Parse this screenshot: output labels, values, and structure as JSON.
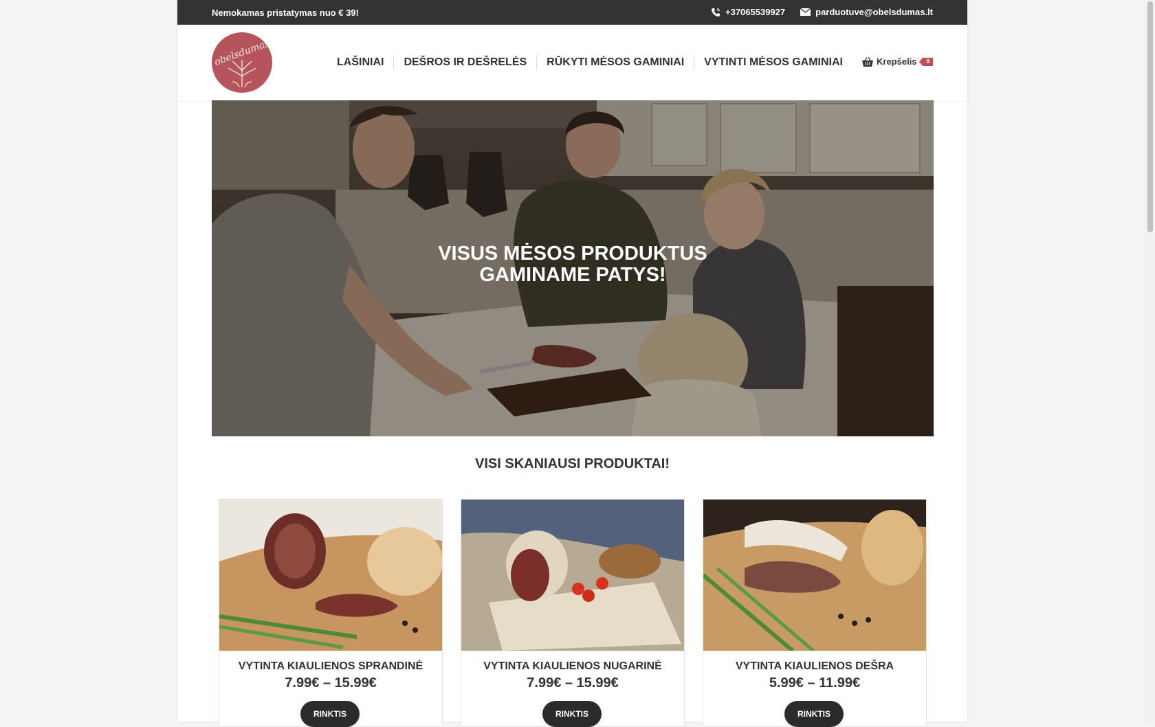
{
  "topbar": {
    "promo": "Nemokamas pristatymas nuo € 39!",
    "phone": "+37065539927",
    "email": "parduotuve@obelsdumas.lt",
    "phone_icon": "phone-icon",
    "email_icon": "envelope-icon"
  },
  "header": {
    "logo_text": "obelsdumas",
    "nav": [
      "LAŠINIAI",
      "DEŠROS IR DEŠRELĖS",
      "RŪKYTI MĖSOS GAMINIAI",
      "VYTINTI MĖSOS GAMINIAI"
    ],
    "cart_label": "Krepšelis",
    "cart_count": "0",
    "cart_icon": "basket-icon"
  },
  "hero": {
    "line1": "VISUS MĖSOS PRODUKTUS",
    "line2": "GAMINAME PATYS!"
  },
  "section_title": "VISI SKANIAUSI PRODUKTAI!",
  "products": [
    {
      "name": "VYTINTA KIAULIENOS SPRANDINĖ",
      "price": "7.99€ – 15.99€",
      "button": "RINKTIS"
    },
    {
      "name": "VYTINTA KIAULIENOS NUGARINĖ",
      "price": "7.99€ – 15.99€",
      "button": "RINKTIS"
    },
    {
      "name": "VYTINTA KIAULIENOS DEŠRA",
      "price": "5.99€ – 11.99€",
      "button": "RINKTIS"
    }
  ],
  "colors": {
    "topbar": "#333333",
    "accent": "#c14d55",
    "logo_bg": "#b5555b",
    "button": "#2b2b2b"
  }
}
